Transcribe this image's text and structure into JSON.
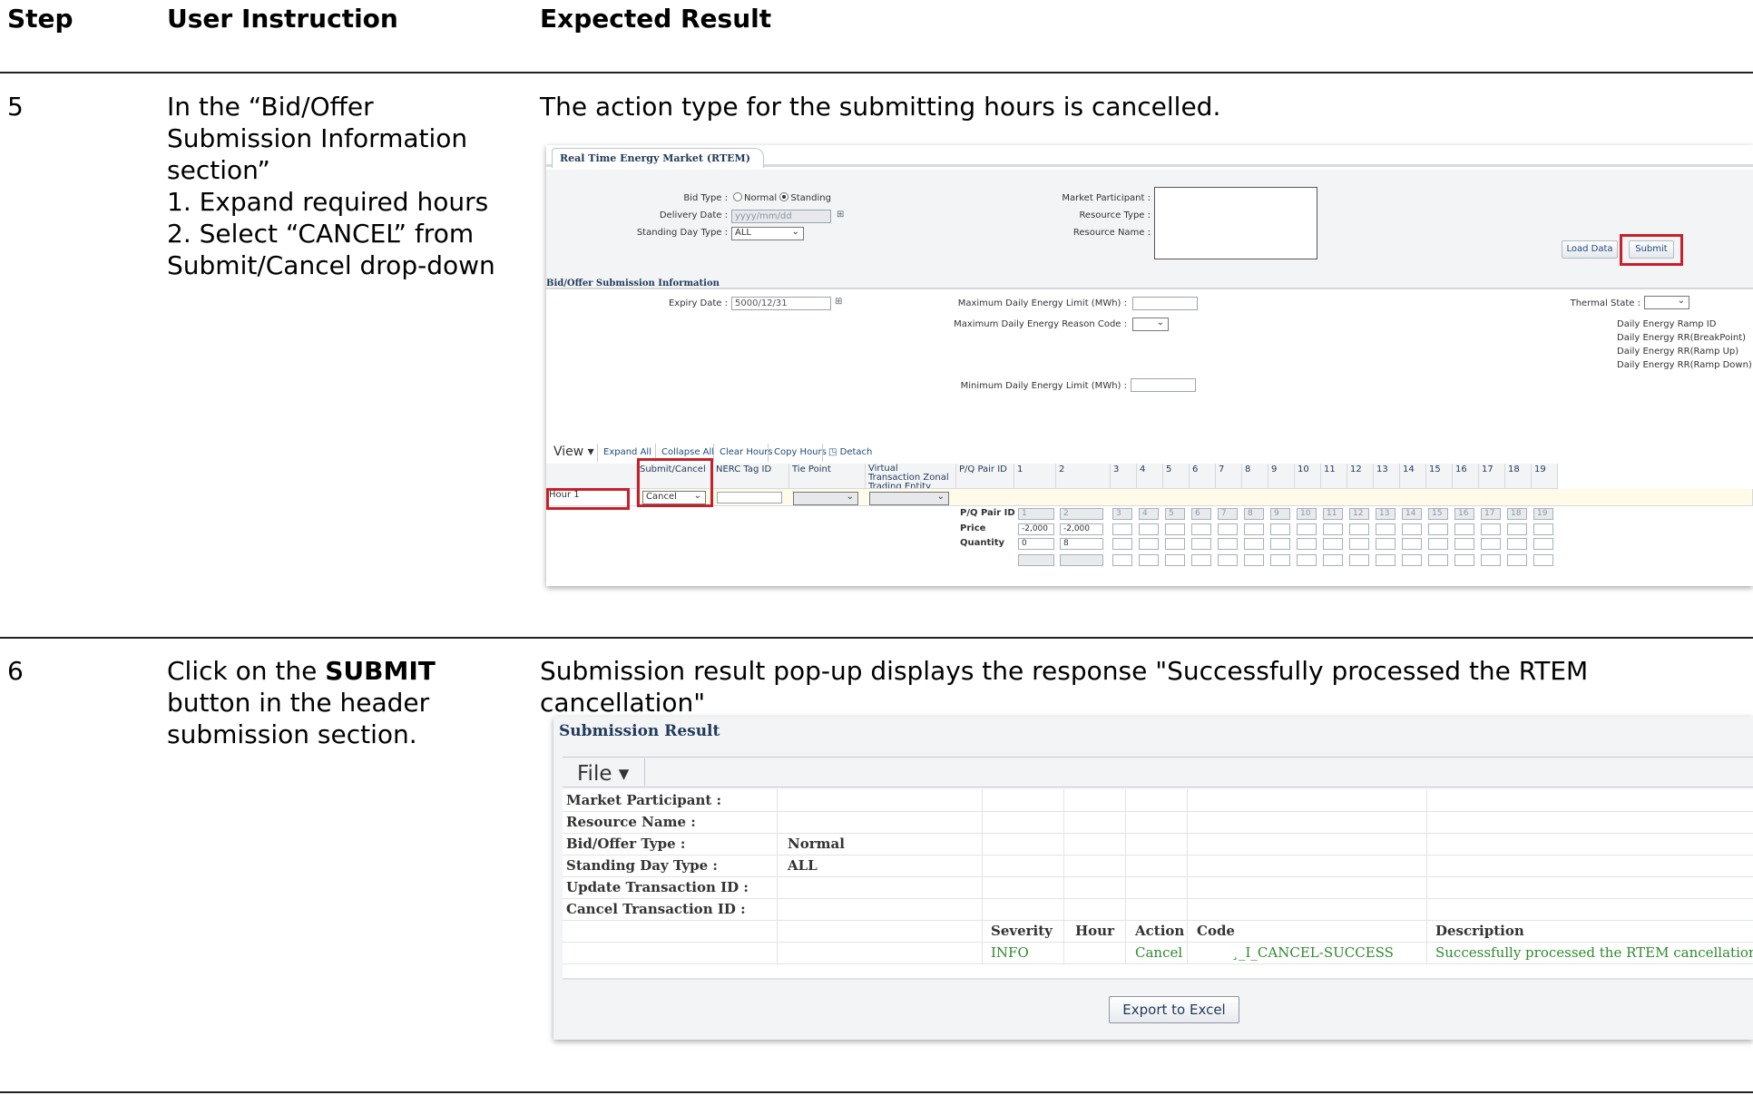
{
  "headers": {
    "step": "Step",
    "instruction": "User Instruction",
    "result": "Expected Result"
  },
  "rows": [
    {
      "step": "5",
      "instruction_lines": [
        "In the “Bid/Offer",
        "Submission Information",
        "section”",
        "1. Expand required hours",
        "2. Select “CANCEL” from",
        "Submit/Cancel drop-down"
      ],
      "result": "The action type for the submitting hours is cancelled."
    },
    {
      "step": "6",
      "instruction_prefix": "Click on the ",
      "instruction_bold": "SUBMIT",
      "instruction_lines": [
        "button in the header",
        "submission section."
      ],
      "result": "Submission result pop-up displays the response \"Successfully processed the RTEM cancellation\""
    }
  ],
  "rtem": {
    "tab": "Real Time Energy Market (RTEM)",
    "bid_type_label": "Bid Type :",
    "bid_type_normal": "Normal",
    "bid_type_standing": "Standing",
    "delivery_date_label": "Delivery Date :",
    "delivery_date_placeholder": "yyyy/mm/dd",
    "standing_day_type_label": "Standing Day Type :",
    "standing_day_type_value": "ALL",
    "market_participant_label": "Market Participant :",
    "resource_type_label": "Resource Type :",
    "resource_name_label": "Resource Name :",
    "load_data_button": "Load Data",
    "submit_button": "Submit",
    "section_title": "Bid/Offer Submission Information",
    "expiry_date_label": "Expiry Date :",
    "expiry_date_value": "5000/12/31",
    "max_energy_limit_label": "Maximum Daily Energy Limit (MWh) :",
    "max_energy_reason_label": "Maximum Daily Energy Reason Code :",
    "min_energy_limit_label": "Minimum Daily Energy Limit (MWh) :",
    "thermal_state_label": "Thermal State :",
    "ramp_labels": [
      "Daily Energy Ramp ID",
      "Daily Energy RR(BreakPoint)",
      "Daily Energy RR(Ramp Up)",
      "Daily Energy RR(Ramp Down)"
    ],
    "toolbar": {
      "view": "View ▾",
      "expand_all": "Expand All",
      "collapse_all": "Collapse All",
      "clear_hours": "Clear Hours",
      "copy_hours": "Copy Hours",
      "detach": "Detach"
    },
    "columns": {
      "submit_cancel": "Submit/Cancel",
      "nerc_tag": "NERC Tag ID",
      "tie_point": "Tie Point",
      "virtual_zonal": "Virtual Transaction Zonal Trading Entity",
      "pq_pair_id": "P/Q Pair ID"
    },
    "hour_numbers": [
      "1",
      "2",
      "3",
      "4",
      "5",
      "6",
      "7",
      "8",
      "9",
      "10",
      "11",
      "12",
      "13",
      "14",
      "15",
      "16",
      "17",
      "18",
      "19"
    ],
    "hour_row": {
      "label": "Hour 1",
      "action": "Cancel"
    },
    "sub_rows": {
      "pq_pair_id": "P/Q Pair ID",
      "price": "Price",
      "quantity": "Quantity"
    },
    "price_values": [
      "-2,000",
      "-2,000"
    ],
    "quantity_values": [
      "0",
      "8"
    ]
  },
  "result_popup": {
    "title": "Submission Result",
    "menu_file": "File ▾",
    "fields": [
      {
        "label": "Market Participant :",
        "value": ""
      },
      {
        "label": "Resource Name :",
        "value": ""
      },
      {
        "label": "Bid/Offer Type :",
        "value": "Normal"
      },
      {
        "label": "Standing Day Type :",
        "value": "ALL"
      },
      {
        "label": "Update Transaction ID :",
        "value": ""
      },
      {
        "label": "Cancel Transaction ID :",
        "value": ""
      }
    ],
    "columns": {
      "severity": "Severity",
      "hour": "Hour",
      "action": "Action",
      "code": "Code",
      "description": "Description"
    },
    "result_row": {
      "severity": "INFO",
      "hour": "",
      "action": "Cancel",
      "code": "̧_I_CANCEL-SUCCESS",
      "description": "Successfully processed the RTEM cancellation."
    },
    "export_button": "Export to Excel"
  }
}
